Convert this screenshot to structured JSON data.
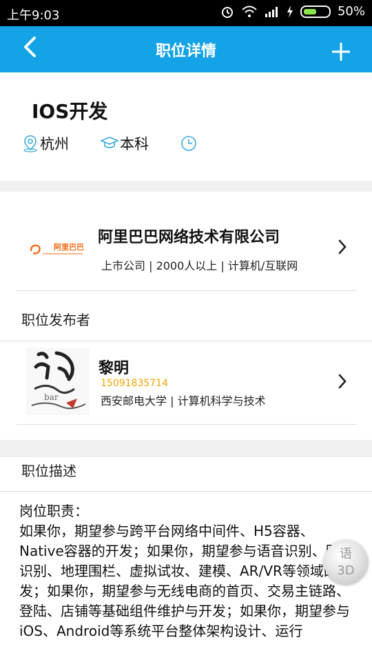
{
  "status_bar": {
    "time": "上午9:03",
    "battery": "50%",
    "icons": [
      "alarm-icon",
      "wifi-icon",
      "signal-icon",
      "charging-icon",
      "battery-icon"
    ]
  },
  "header": {
    "title": "职位详情",
    "back_icon": "chevron-left-icon",
    "add_icon": "plus-icon",
    "color": "#13a3e6"
  },
  "job": {
    "title": "IOS开发",
    "location": "杭州",
    "degree": "本科",
    "time": ""
  },
  "company": {
    "logo_text": "阿里巴巴",
    "name": "阿里巴巴网络技术有限公司",
    "meta": "上市公司 | 2000人以上 | 计算机/互联网"
  },
  "publisher": {
    "section_label": "职位发布者",
    "name": "黎明",
    "phone": "15091835714",
    "school": "西安邮电大学 | 计算机科学与技术"
  },
  "description": {
    "section_label": "职位描述",
    "heading": "岗位职责：",
    "text": "如果你，期望参与跨平台网络中间件、H5容器、Native容器的开发；如果你，期望参与语音识别、图像识别、地理围栏、虚拟试妆、建模、AR/VR等领域的开发；如果你，期望参与无线电商的首页、交易主链路、登陆、店铺等基础组件维护与开发；如果你，期望参与iOS、Android等系统平台整体架构设计、运行"
  },
  "floating_button": {
    "line1": "语",
    "line2": "3D"
  }
}
